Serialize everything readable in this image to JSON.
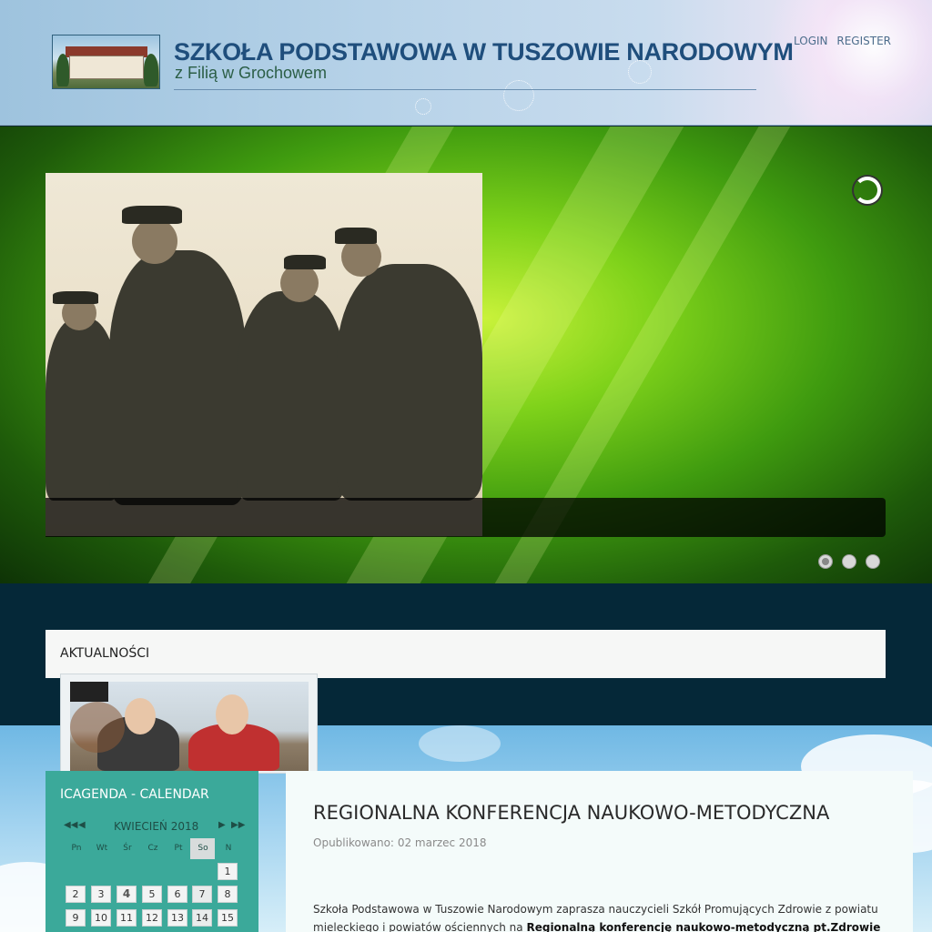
{
  "header": {
    "title": "SZKOŁA PODSTAWOWA W TUSZOWIE NARODOWYM",
    "subtitle": "z Filią w Grochowem",
    "login": "LOGIN",
    "register": "REGISTER"
  },
  "slider": {
    "slide_count": 3,
    "active_slide": 1
  },
  "news": {
    "label": "AKTUALNOŚCI"
  },
  "calendar": {
    "title": "ICAGENDA - CALENDAR",
    "month": "KWIECIEŃ 2018",
    "day_names": [
      "Pn",
      "Wt",
      "Śr",
      "Cz",
      "Pt",
      "So",
      "N"
    ],
    "rows": [
      [
        "",
        "",
        "",
        "",
        "",
        "",
        "1"
      ],
      [
        "2",
        "3",
        "4",
        "5",
        "6",
        "7",
        "8"
      ],
      [
        "9",
        "10",
        "11",
        "12",
        "13",
        "14",
        "15"
      ]
    ],
    "today": "4"
  },
  "article": {
    "title": "REGIONALNA KONFERENCJA NAUKOWO-METODYCZNA",
    "meta_label": "Opublikowano:",
    "meta_date": "02 marzec 2018",
    "text_line1": "Szkoła Podstawowa w Tuszowie Narodowym zaprasza nauczycieli Szkół Promujących Zdrowie z powiatu",
    "text_line2_start": "mieleckiego i powiatów ościennych  na ",
    "text_line2_bold": "Regionalną konferencję naukowo-metodyczną pt.Zdrowie"
  }
}
